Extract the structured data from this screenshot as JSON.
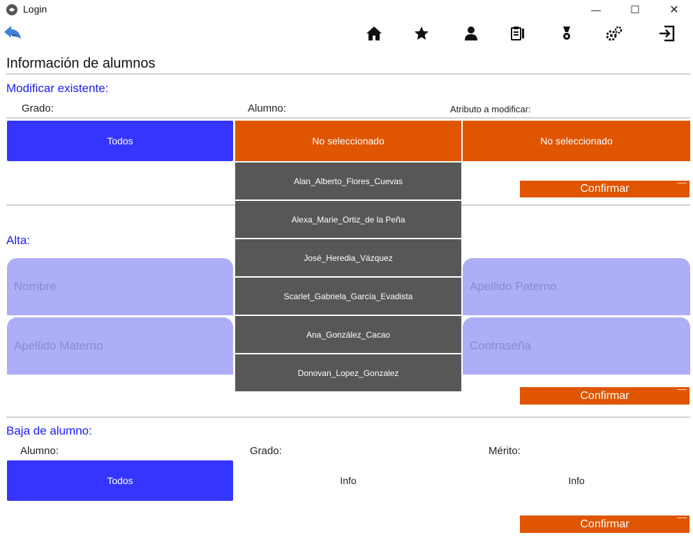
{
  "window": {
    "title": "Login",
    "minimize_glyph": "—",
    "maximize_glyph": "☐",
    "close_glyph": "✕"
  },
  "toolbar": {
    "icons": [
      "back-arrow-icon",
      "home-icon",
      "star-icon",
      "user-icon",
      "notes-icon",
      "medal-icon",
      "gears-icon",
      "logout-icon"
    ]
  },
  "page": {
    "title": "Información de alumnos"
  },
  "modify": {
    "heading": "Modificar existente:",
    "grado_label": "Grado:",
    "alumno_label": "Alumno:",
    "atributo_label": "Atributo a modificar:",
    "grado_value": "Todos",
    "alumno_value": "No seleccionado",
    "atributo_value": "No seleccionado",
    "confirm_label": "Confirmar"
  },
  "dropdown": {
    "items": [
      "Alan_Alberto_Flores_Cuevas",
      "Alexa_Marie_Ortiz_de la Peña",
      "José_Heredia_Vázquez",
      "Scarlet_Gabriela_García_Evadista",
      "Ana_González_Cacao",
      "Donovan_Lopez_Gonzalez"
    ]
  },
  "alta": {
    "heading": "Alta:",
    "nombre_placeholder": "Nombre",
    "apellido_paterno_placeholder": "Apellido Paterno",
    "apellido_materno_placeholder": "Apellido Materno",
    "contrasena_placeholder": "Contraseña",
    "confirm_label": "Confirmar"
  },
  "baja": {
    "heading": "Baja de alumno:",
    "alumno_label": "Alumno:",
    "grado_label": "Grado:",
    "merito_label": "Mérito:",
    "alumno_value": "Todos",
    "grado_value": "Info",
    "merito_value": "Info",
    "confirm_label": "Confirmar"
  },
  "colors": {
    "blue": "#3535ff",
    "orange": "#e05500",
    "field": "#aeaef8",
    "dropdown": "#575757",
    "heading_blue": "#1a1aff"
  }
}
